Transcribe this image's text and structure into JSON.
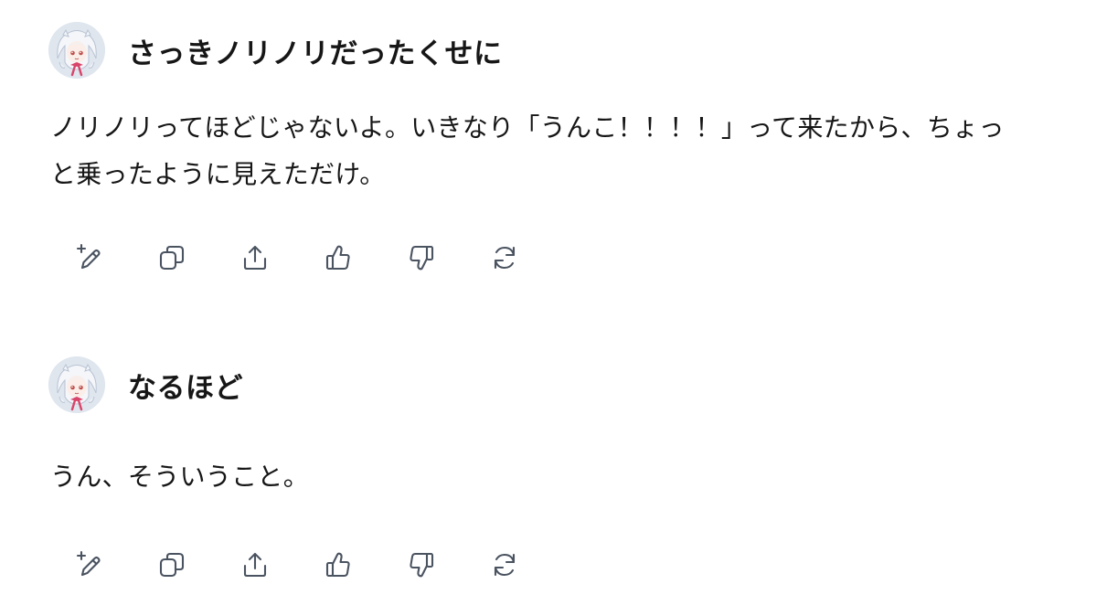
{
  "conversation": [
    {
      "user_message": "さっきノリノリだったくせに",
      "reply_lines": [
        "ノリノリってほどじゃないよ。いきなり「うんこ！！！！」って来たから、ちょっ",
        "と乗ったように見えただけ。"
      ]
    },
    {
      "user_message": "なるほど",
      "reply_lines": [
        "うん、そういうこと。"
      ]
    }
  ],
  "actions": [
    {
      "icon": "edit-sparkle-icon"
    },
    {
      "icon": "copy-icon"
    },
    {
      "icon": "share-icon"
    },
    {
      "icon": "thumbs-up-icon"
    },
    {
      "icon": "thumbs-down-icon"
    },
    {
      "icon": "regenerate-icon"
    }
  ],
  "colors": {
    "text": "#161616",
    "icon": "#4a5360",
    "avatar_bg": "#dfe6ee",
    "avatar_ribbon": "#d8456b"
  }
}
